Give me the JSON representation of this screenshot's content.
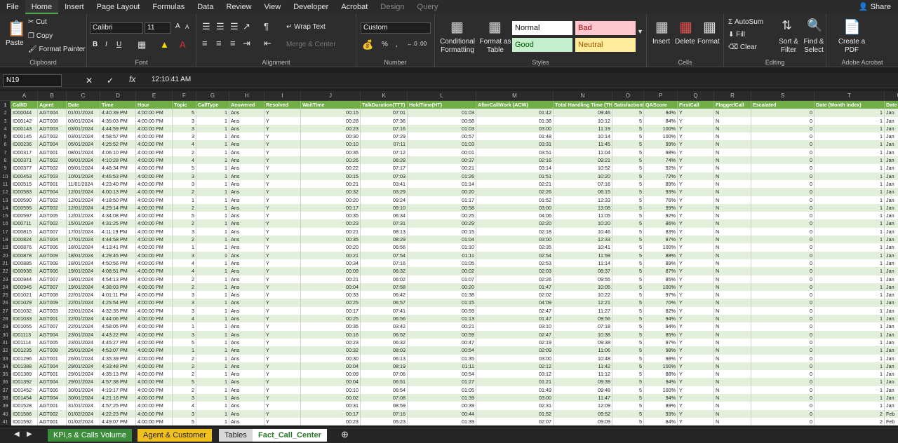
{
  "menu": {
    "tabs": [
      "File",
      "Home",
      "Insert",
      "Page Layout",
      "Formulas",
      "Data",
      "Review",
      "View",
      "Developer",
      "Acrobat",
      "Design",
      "Query"
    ],
    "share": "Share"
  },
  "ribbon": {
    "clipboard": {
      "label": "Clipboard",
      "paste": "Paste",
      "cut": "Cut",
      "copy": "Copy",
      "painter": "Format Painter"
    },
    "font": {
      "label": "Font",
      "name": "Calibri",
      "size": "11",
      "grow": "A",
      "shrink": "A",
      "bold": "B",
      "italic": "I",
      "underline": "U"
    },
    "alignment": {
      "label": "Alignment",
      "wrap": "Wrap Text",
      "merge": "Merge & Center"
    },
    "number": {
      "label": "Number",
      "format": "Custom",
      "percent": "%",
      "comma": ","
    },
    "styles": {
      "label": "Styles",
      "conditional": "Conditional Formatting",
      "format_table": "Format as Table",
      "normal": "Normal",
      "bad": "Bad",
      "good": "Good",
      "neutral": "Neutral"
    },
    "cells": {
      "label": "Cells",
      "insert": "Insert",
      "delete": "Delete",
      "format": "Format"
    },
    "editing": {
      "label": "Editing",
      "autosum": "AutoSum",
      "fill": "Fill",
      "clear": "Clear",
      "sort": "Sort & Filter",
      "find": "Find & Select"
    },
    "acrobat": {
      "label": "Adobe Acrobat",
      "create": "Create a PDF"
    }
  },
  "formula_bar": {
    "name_box": "N19",
    "fx": "fx",
    "value": "12:10:41 AM"
  },
  "columns": [
    "A",
    "B",
    "C",
    "D",
    "E",
    "F",
    "G",
    "H",
    "I",
    "J",
    "K",
    "L",
    "M",
    "N",
    "O",
    "P",
    "Q",
    "R",
    "S",
    "T",
    "U"
  ],
  "headers": [
    "CallID",
    "Agent",
    "Date",
    "Time",
    "Hour",
    "Topic",
    "CallType",
    "Answered",
    "Resolved",
    "WaitTime",
    "TalkDuration(TTT)",
    "HoldTime(HT)",
    "AfterCallWork (ACW)",
    "Total Handling Time (THT)",
    "SatisfactionRating",
    "QAScore",
    "FirstCall",
    "FlaggedCall",
    "Escalated",
    "Date (Month Index)",
    "Date (Mon"
  ],
  "rows": [
    [
      "ID00044",
      "AGT004",
      "01/01/2024",
      "4:40:39 PM",
      "4:00:00 PM",
      "5",
      "1",
      "Ans",
      "Y",
      "00:15",
      "07:01",
      "01:03",
      "01:42",
      "09:46",
      "5",
      "94%",
      "Y",
      "N",
      "0",
      "1",
      "Jan"
    ],
    [
      "ID00142",
      "AGT008",
      "03/01/2024",
      "4:35:03 PM",
      "4:00:00 PM",
      "3",
      "1",
      "Ans",
      "Y",
      "00:28",
      "07:36",
      "00:58",
      "01:38",
      "10:12",
      "5",
      "84%",
      "Y",
      "N",
      "0",
      "1",
      "Jan"
    ],
    [
      "ID00143",
      "AGT003",
      "03/01/2024",
      "4:44:59 PM",
      "4:00:00 PM",
      "3",
      "1",
      "Ans",
      "Y",
      "00:23",
      "07:16",
      "01:03",
      "03:00",
      "11:19",
      "5",
      "100%",
      "Y",
      "N",
      "0",
      "1",
      "Jan"
    ],
    [
      "ID00145",
      "AGT002",
      "03/01/2024",
      "4:58:57 PM",
      "4:00:00 PM",
      "3",
      "1",
      "Ans",
      "Y",
      "00:30",
      "07:29",
      "00:57",
      "01:48",
      "10:14",
      "5",
      "100%",
      "Y",
      "N",
      "0",
      "1",
      "Jan"
    ],
    [
      "ID00236",
      "AGT004",
      "05/01/2024",
      "4:25:52 PM",
      "4:00:00 PM",
      "4",
      "1",
      "Ans",
      "Y",
      "00:10",
      "07:11",
      "01:03",
      "03:31",
      "11:45",
      "5",
      "99%",
      "Y",
      "N",
      "0",
      "1",
      "Jan"
    ],
    [
      "ID00317",
      "AGT001",
      "08/01/2024",
      "4:06:10 PM",
      "4:00:00 PM",
      "2",
      "1",
      "Ans",
      "Y",
      "00:35",
      "07:12",
      "00:01",
      "03:51",
      "11:04",
      "5",
      "98%",
      "Y",
      "N",
      "0",
      "1",
      "Jan"
    ],
    [
      "ID00371",
      "AGT002",
      "09/01/2024",
      "4:10:28 PM",
      "4:00:00 PM",
      "4",
      "1",
      "Ans",
      "Y",
      "00:26",
      "06:28",
      "00:37",
      "02:16",
      "09:21",
      "5",
      "74%",
      "Y",
      "N",
      "0",
      "1",
      "Jan"
    ],
    [
      "ID00377",
      "AGT002",
      "09/01/2024",
      "4:48:34 PM",
      "4:00:00 PM",
      "5",
      "1",
      "Ans",
      "Y",
      "00:22",
      "07:17",
      "00:21",
      "03:14",
      "10:52",
      "5",
      "92%",
      "Y",
      "N",
      "0",
      "1",
      "Jan"
    ],
    [
      "ID00453",
      "AGT003",
      "10/01/2024",
      "4:45:53 PM",
      "4:00:00 PM",
      "3",
      "1",
      "Ans",
      "Y",
      "00:15",
      "07:03",
      "01:26",
      "01:51",
      "10:20",
      "5",
      "72%",
      "Y",
      "N",
      "0",
      "1",
      "Jan"
    ],
    [
      "ID00515",
      "AGT001",
      "11/01/2024",
      "4:23:40 PM",
      "4:00:00 PM",
      "3",
      "1",
      "Ans",
      "Y",
      "00:21",
      "03:41",
      "01:14",
      "02:21",
      "07:16",
      "5",
      "89%",
      "Y",
      "N",
      "0",
      "1",
      "Jan"
    ],
    [
      "ID00583",
      "AGT004",
      "12/01/2024",
      "4:00:13 PM",
      "4:00:00 PM",
      "2",
      "1",
      "Ans",
      "Y",
      "00:32",
      "03:29",
      "00:20",
      "02:26",
      "06:15",
      "5",
      "93%",
      "Y",
      "N",
      "0",
      "1",
      "Jan"
    ],
    [
      "ID00590",
      "AGT002",
      "12/01/2024",
      "4:18:50 PM",
      "4:00:00 PM",
      "1",
      "1",
      "Ans",
      "Y",
      "00:20",
      "09:24",
      "01:17",
      "01:52",
      "12:33",
      "5",
      "76%",
      "Y",
      "N",
      "0",
      "1",
      "Jan"
    ],
    [
      "ID00595",
      "AGT002",
      "12/01/2024",
      "4:29:14 PM",
      "4:00:00 PM",
      "2",
      "1",
      "Ans",
      "Y",
      "00:17",
      "09:10",
      "00:58",
      "03:00",
      "13:08",
      "5",
      "99%",
      "Y",
      "N",
      "0",
      "1",
      "Jan"
    ],
    [
      "ID00597",
      "AGT005",
      "12/01/2024",
      "4:34:08 PM",
      "4:00:00 PM",
      "5",
      "1",
      "Ans",
      "Y",
      "00:35",
      "06:34",
      "00:25",
      "04:06",
      "11:05",
      "5",
      "92%",
      "Y",
      "N",
      "0",
      "1",
      "Jan"
    ],
    [
      "ID00711",
      "AGT002",
      "15/01/2024",
      "4:31:25 PM",
      "4:00:00 PM",
      "2",
      "1",
      "Ans",
      "Y",
      "00:23",
      "07:31",
      "00:29",
      "02:20",
      "10:20",
      "5",
      "86%",
      "Y",
      "N",
      "0",
      "1",
      "Jan"
    ],
    [
      "ID00815",
      "AGT007",
      "17/01/2024",
      "4:11:19 PM",
      "4:00:00 PM",
      "3",
      "1",
      "Ans",
      "Y",
      "00:21",
      "08:13",
      "00:15",
      "02:18",
      "10:46",
      "5",
      "83%",
      "Y",
      "N",
      "0",
      "1",
      "Jan"
    ],
    [
      "ID00824",
      "AGT004",
      "17/01/2024",
      "4:44:58 PM",
      "4:00:00 PM",
      "2",
      "1",
      "Ans",
      "Y",
      "00:35",
      "08:29",
      "01:04",
      "03:00",
      "12:33",
      "5",
      "87%",
      "Y",
      "N",
      "0",
      "1",
      "Jan"
    ],
    [
      "ID00876",
      "AGT006",
      "18/01/2024",
      "4:13:41 PM",
      "4:00:00 PM",
      "1",
      "1",
      "Ans",
      "Y",
      "00:20",
      "06:56",
      "01:10",
      "02:35",
      "10:41",
      "5",
      "100%",
      "Y",
      "N",
      "0",
      "1",
      "Jan"
    ],
    [
      "ID00878",
      "AGT009",
      "18/01/2024",
      "4:29:45 PM",
      "4:00:00 PM",
      "3",
      "1",
      "Ans",
      "Y",
      "00:21",
      "07:54",
      "01:11",
      "02:54",
      "11:59",
      "5",
      "88%",
      "Y",
      "N",
      "0",
      "1",
      "Jan"
    ],
    [
      "ID00885",
      "AGT008",
      "18/01/2024",
      "4:50:56 PM",
      "4:00:00 PM",
      "4",
      "1",
      "Ans",
      "Y",
      "00:34",
      "07:16",
      "01:05",
      "02:53",
      "11:14",
      "5",
      "89%",
      "Y",
      "N",
      "0",
      "1",
      "Jan"
    ],
    [
      "ID00938",
      "AGT006",
      "19/01/2024",
      "4:08:51 PM",
      "4:00:00 PM",
      "4",
      "1",
      "Ans",
      "Y",
      "00:09",
      "06:32",
      "00:02",
      "02:03",
      "08:37",
      "5",
      "87%",
      "Y",
      "N",
      "0",
      "1",
      "Jan"
    ],
    [
      "ID00944",
      "AGT007",
      "19/01/2024",
      "4:54:13 PM",
      "4:00:00 PM",
      "2",
      "1",
      "Ans",
      "Y",
      "00:21",
      "06:02",
      "01:07",
      "02:26",
      "09:55",
      "5",
      "85%",
      "Y",
      "N",
      "0",
      "1",
      "Jan"
    ],
    [
      "ID00945",
      "AGT007",
      "19/01/2024",
      "4:38:03 PM",
      "4:00:00 PM",
      "2",
      "1",
      "Ans",
      "Y",
      "00:04",
      "07:58",
      "00:20",
      "01:47",
      "10:05",
      "5",
      "100%",
      "Y",
      "N",
      "0",
      "1",
      "Jan"
    ],
    [
      "ID01021",
      "AGT008",
      "22/01/2024",
      "4:01:11 PM",
      "4:00:00 PM",
      "3",
      "1",
      "Ans",
      "Y",
      "00:33",
      "06:42",
      "01:38",
      "02:02",
      "10:22",
      "5",
      "97%",
      "Y",
      "N",
      "0",
      "1",
      "Jan"
    ],
    [
      "ID01029",
      "AGT009",
      "22/01/2024",
      "4:25:54 PM",
      "4:00:00 PM",
      "3",
      "1",
      "Ans",
      "Y",
      "00:25",
      "06:57",
      "01:15",
      "04:09",
      "12:21",
      "5",
      "70%",
      "Y",
      "N",
      "0",
      "1",
      "Jan"
    ],
    [
      "ID01032",
      "AGT003",
      "22/01/2024",
      "4:32:35 PM",
      "4:00:00 PM",
      "3",
      "1",
      "Ans",
      "Y",
      "00:17",
      "07:41",
      "00:59",
      "02:47",
      "11:27",
      "5",
      "82%",
      "Y",
      "N",
      "0",
      "1",
      "Jan"
    ],
    [
      "ID01033",
      "AGT001",
      "22/01/2024",
      "4:44:06 PM",
      "4:00:00 PM",
      "4",
      "1",
      "Ans",
      "Y",
      "00:25",
      "06:56",
      "01:13",
      "01:47",
      "09:56",
      "5",
      "94%",
      "Y",
      "N",
      "0",
      "1",
      "Jan"
    ],
    [
      "ID01055",
      "AGT007",
      "22/01/2024",
      "4:58:05 PM",
      "4:00:00 PM",
      "1",
      "1",
      "Ans",
      "Y",
      "00:35",
      "03:42",
      "00:21",
      "03:10",
      "07:18",
      "5",
      "94%",
      "Y",
      "N",
      "0",
      "1",
      "Jan"
    ],
    [
      "ID01113",
      "AGT004",
      "23/01/2024",
      "4:43:22 PM",
      "4:00:00 PM",
      "3",
      "1",
      "Ans",
      "Y",
      "00:16",
      "06:52",
      "00:59",
      "02:47",
      "10:38",
      "5",
      "85%",
      "Y",
      "N",
      "0",
      "1",
      "Jan"
    ],
    [
      "ID01114",
      "AGT005",
      "23/01/2024",
      "4:45:27 PM",
      "4:00:00 PM",
      "5",
      "1",
      "Ans",
      "Y",
      "00:23",
      "06:32",
      "00:47",
      "02:19",
      "09:38",
      "5",
      "97%",
      "Y",
      "N",
      "0",
      "1",
      "Jan"
    ],
    [
      "ID01235",
      "AGT008",
      "25/01/2024",
      "4:53:07 PM",
      "4:00:00 PM",
      "1",
      "1",
      "Ans",
      "Y",
      "00:32",
      "08:03",
      "00:54",
      "02:09",
      "11:06",
      "5",
      "98%",
      "Y",
      "N",
      "0",
      "1",
      "Jan"
    ],
    [
      "ID01296",
      "AGT001",
      "26/01/2024",
      "4:35:39 PM",
      "4:00:00 PM",
      "2",
      "1",
      "Ans",
      "Y",
      "00:30",
      "06:13",
      "01:35",
      "03:00",
      "10:48",
      "5",
      "98%",
      "Y",
      "N",
      "0",
      "1",
      "Jan"
    ],
    [
      "ID01388",
      "AGT004",
      "29/01/2024",
      "4:33:48 PM",
      "4:00:00 PM",
      "2",
      "1",
      "Ans",
      "Y",
      "00:04",
      "08:19",
      "01:11",
      "02:12",
      "11:42",
      "5",
      "100%",
      "Y",
      "N",
      "0",
      "1",
      "Jan"
    ],
    [
      "ID01389",
      "AGT001",
      "29/01/2024",
      "4:35:13 PM",
      "4:00:00 PM",
      "2",
      "1",
      "Ans",
      "Y",
      "00:09",
      "07:06",
      "00:54",
      "03:12",
      "11:12",
      "5",
      "88%",
      "Y",
      "N",
      "0",
      "1",
      "Jan"
    ],
    [
      "ID01392",
      "AGT004",
      "29/01/2024",
      "4:57:38 PM",
      "4:00:00 PM",
      "5",
      "1",
      "Ans",
      "Y",
      "00:04",
      "06:51",
      "01:27",
      "01:21",
      "09:39",
      "5",
      "94%",
      "Y",
      "N",
      "0",
      "1",
      "Jan"
    ],
    [
      "ID01452",
      "AGT006",
      "30/01/2024",
      "4:19:17 PM",
      "4:00:00 PM",
      "2",
      "1",
      "Ans",
      "Y",
      "00:10",
      "06:54",
      "01:05",
      "01:49",
      "09:48",
      "5",
      "100%",
      "Y",
      "N",
      "0",
      "1",
      "Jan"
    ],
    [
      "ID01454",
      "AGT004",
      "30/01/2024",
      "4:21:16 PM",
      "4:00:00 PM",
      "3",
      "1",
      "Ans",
      "Y",
      "00:02",
      "07:08",
      "01:39",
      "03:00",
      "11:47",
      "5",
      "94%",
      "Y",
      "N",
      "0",
      "1",
      "Jan"
    ],
    [
      "ID01528",
      "AGT001",
      "31/01/2024",
      "4:57:25 PM",
      "4:00:00 PM",
      "4",
      "1",
      "Ans",
      "Y",
      "00:31",
      "08:59",
      "00:39",
      "02:31",
      "12:09",
      "5",
      "89%",
      "Y",
      "N",
      "0",
      "1",
      "Jan"
    ],
    [
      "ID01586",
      "AGT002",
      "01/02/2024",
      "4:22:23 PM",
      "4:00:00 PM",
      "3",
      "1",
      "Ans",
      "Y",
      "00:17",
      "07:16",
      "00:44",
      "01:52",
      "09:52",
      "5",
      "93%",
      "Y",
      "N",
      "0",
      "2",
      "Feb"
    ],
    [
      "ID01592",
      "AGT001",
      "01/02/2024",
      "4:49:07 PM",
      "4:00:00 PM",
      "5",
      "1",
      "Ans",
      "Y",
      "00:23",
      "05:23",
      "01:39",
      "02:07",
      "09:09",
      "5",
      "84%",
      "Y",
      "N",
      "0",
      "2",
      "Feb"
    ]
  ],
  "sheet_tabs": [
    {
      "label": "KPI,s & Calls Volume",
      "color": "#3c8c3c"
    },
    {
      "label": "Agent & Customer",
      "color": "#f0c020"
    },
    {
      "label": "Tables",
      "color": "#d8d8d8"
    },
    {
      "label": "Fact_Call_Center",
      "color": "#ffffff"
    }
  ]
}
